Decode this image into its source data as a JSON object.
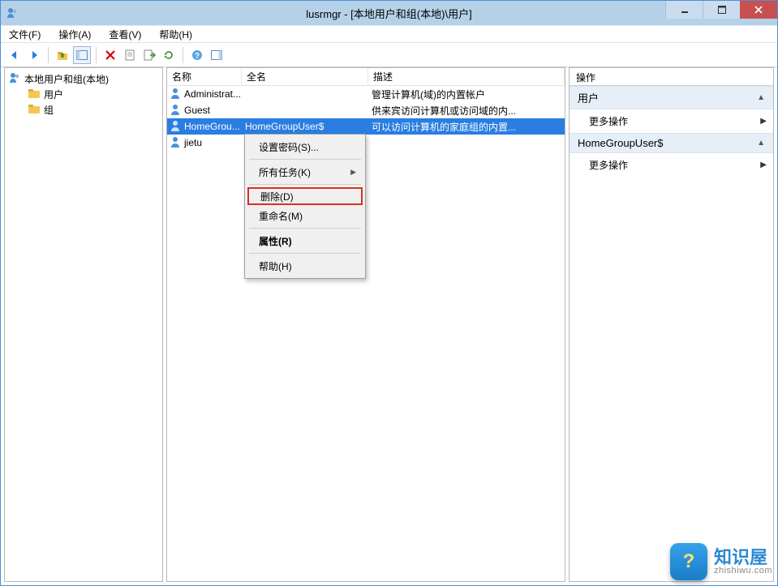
{
  "window": {
    "title": "lusrmgr - [本地用户和组(本地)\\用户]"
  },
  "menubar": {
    "file": "文件(F)",
    "action": "操作(A)",
    "view": "查看(V)",
    "help": "帮助(H)"
  },
  "tree": {
    "root": "本地用户和组(本地)",
    "users": "用户",
    "groups": "组"
  },
  "list": {
    "headers": {
      "name": "名称",
      "fullname": "全名",
      "desc": "描述"
    },
    "rows": [
      {
        "name": "Administrat...",
        "fullname": "",
        "desc": "管理计算机(域)的内置帐户"
      },
      {
        "name": "Guest",
        "fullname": "",
        "desc": "供来宾访问计算机或访问域的内..."
      },
      {
        "name": "HomeGrou...",
        "fullname": "HomeGroupUser$",
        "desc": "可以访问计算机的家庭组的内置..."
      },
      {
        "name": "jietu",
        "fullname": "",
        "desc": ""
      }
    ]
  },
  "contextmenu": {
    "setpwd": "设置密码(S)...",
    "alltasks": "所有任务(K)",
    "delete": "删除(D)",
    "rename": "重命名(M)",
    "properties": "属性(R)",
    "help": "帮助(H)"
  },
  "actionpane": {
    "header": "操作",
    "section1_title": "用户",
    "section1_more": "更多操作",
    "section2_title": "HomeGroupUser$",
    "section2_more": "更多操作"
  },
  "watermark": {
    "cn": "知识屋",
    "url": "zhishiwu.com",
    "badge": "?"
  }
}
